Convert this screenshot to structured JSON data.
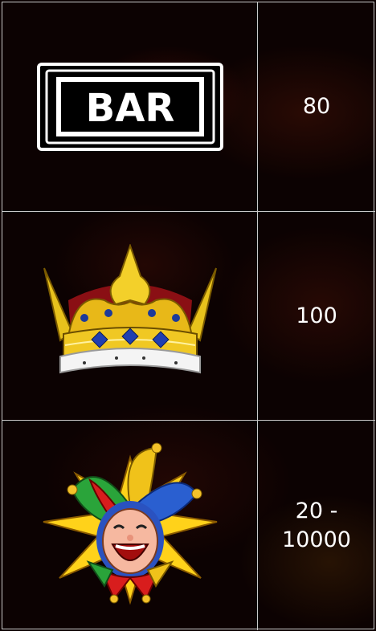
{
  "paytable": {
    "rows": [
      {
        "symbol": "bar-symbol",
        "bar_text": "BAR",
        "payout": "80"
      },
      {
        "symbol": "crown-symbol",
        "payout": "100"
      },
      {
        "symbol": "jester-symbol",
        "payout": "20 -\n10000"
      }
    ]
  },
  "colors": {
    "grid_line": "#c9c9c9",
    "text": "#ffffff",
    "background": "#0c0202"
  }
}
